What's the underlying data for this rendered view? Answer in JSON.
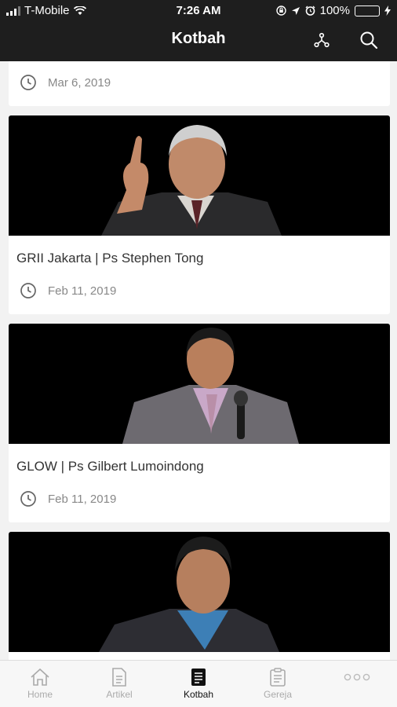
{
  "status_bar": {
    "carrier": "T-Mobile",
    "time": "7:26 AM",
    "battery": "100%"
  },
  "nav": {
    "title": "Kotbah",
    "share_icon": "share-network-icon",
    "search_icon": "search-icon"
  },
  "cards": [
    {
      "title": "",
      "date": "Mar 6, 2019"
    },
    {
      "title": "GRII Jakarta | Ps Stephen Tong",
      "date": "Feb 11, 2019"
    },
    {
      "title": "GLOW | Ps Gilbert Lumoindong",
      "date": "Feb 11, 2019"
    },
    {
      "title": "",
      "date": ""
    }
  ],
  "tabs": [
    {
      "label": "Home",
      "icon": "home-icon"
    },
    {
      "label": "Artikel",
      "icon": "document-icon"
    },
    {
      "label": "Kotbah",
      "icon": "list-document-icon"
    },
    {
      "label": "Gereja",
      "icon": "clipboard-icon"
    },
    {
      "label": "",
      "icon": "more-icon"
    }
  ],
  "colors": {
    "header_bg": "#1e1e1e",
    "page_bg": "#f2f2f2",
    "battery_green": "#4cd964",
    "active_tab": "#111111",
    "inactive_tab": "#aaaaaa"
  }
}
